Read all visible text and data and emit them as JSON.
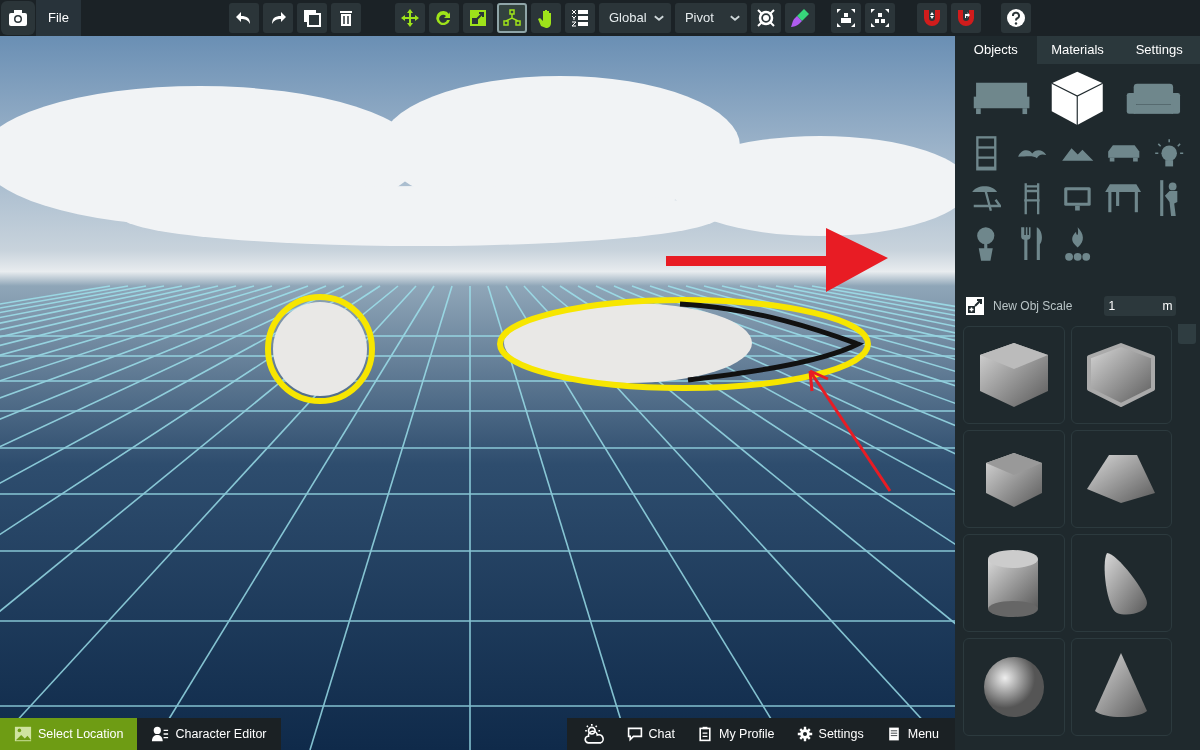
{
  "toolbar": {
    "file_menu": "File",
    "groups": [
      [
        {
          "kind": "tool",
          "selected": false
        },
        {
          "kind": "tool",
          "selected": false
        },
        {
          "kind": "tool",
          "selected": false
        },
        {
          "kind": "tool",
          "selected": false
        }
      ],
      [
        {
          "kind": "tool",
          "selected": false
        },
        {
          "kind": "tool",
          "selected": false
        },
        {
          "kind": "tool",
          "selected": false
        },
        {
          "kind": "tool",
          "selected": true
        },
        {
          "kind": "tool",
          "selected": false
        },
        {
          "kind": "tool",
          "selected": false
        },
        {
          "kind": "dropdown",
          "value": "Global"
        },
        {
          "kind": "dropdown",
          "value": "Pivot"
        },
        {
          "kind": "tool",
          "selected": false
        },
        {
          "kind": "tool",
          "selected": false
        }
      ],
      [
        {
          "kind": "tool",
          "selected": false
        },
        {
          "kind": "tool",
          "selected": false
        }
      ],
      [
        {
          "kind": "tool",
          "selected": false
        },
        {
          "kind": "tool",
          "selected": false
        }
      ],
      [
        {
          "kind": "tool",
          "selected": false
        }
      ]
    ]
  },
  "panel": {
    "tabs": [
      {
        "label": "Objects",
        "selected": true
      },
      {
        "label": "Materials",
        "selected": false
      },
      {
        "label": "Settings",
        "selected": false
      }
    ],
    "categories": [
      {
        "selected": false
      },
      {
        "selected": true
      },
      {
        "selected": false
      },
      {
        "selected": false
      },
      {
        "selected": false
      },
      {
        "selected": false
      },
      {
        "selected": false
      },
      {
        "selected": false
      },
      {
        "selected": false
      },
      {
        "selected": false
      },
      {
        "selected": false
      },
      {
        "selected": false
      },
      {
        "selected": false
      },
      {
        "selected": false
      },
      {
        "selected": false
      },
      {
        "selected": false
      }
    ],
    "scale": {
      "label": "New Obj Scale",
      "value": "1",
      "unit": "m"
    }
  },
  "bottom_left": [
    {
      "label": "Select Location",
      "selected": true
    },
    {
      "label": "Character Editor",
      "selected": false
    }
  ],
  "bottom_right": [
    "Chat",
    "My Profile",
    "Settings",
    "Menu"
  ]
}
